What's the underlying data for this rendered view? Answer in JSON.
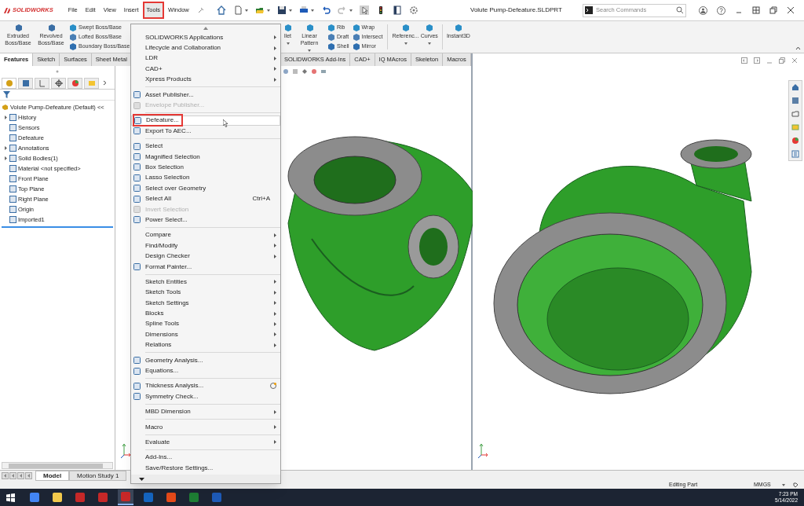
{
  "title_bar": {
    "app_name": "SOLIDWORKS",
    "menus": [
      {
        "label": "File",
        "selected": false,
        "annotated": false
      },
      {
        "label": "Edit",
        "selected": false,
        "annotated": false
      },
      {
        "label": "View",
        "selected": false,
        "annotated": false
      },
      {
        "label": "Insert",
        "selected": false,
        "annotated": false
      },
      {
        "label": "Tools",
        "selected": true,
        "annotated": true
      },
      {
        "label": "Window",
        "selected": false,
        "annotated": false
      }
    ],
    "document_title": "Volute Pump-Defeature.SLDPRT",
    "search": {
      "placeholder": "Search Commands"
    }
  },
  "ribbon": {
    "column_groups": [
      [
        {
          "kind": "large",
          "label": "Extruded Boss/Base"
        },
        {
          "kind": "large",
          "label": "Revolved Boss/Base"
        },
        {
          "kind": "stack",
          "items": [
            "Swept Boss/Base",
            "Lofted Boss/Base",
            "Boundary Boss/Base"
          ]
        }
      ],
      [
        {
          "kind": "large",
          "label": "llet",
          "dropdown": true
        },
        {
          "kind": "large",
          "label": "Linear Pattern",
          "dropdown": true
        },
        {
          "kind": "stack",
          "items": [
            "Rib",
            "Draft",
            "Shell"
          ]
        },
        {
          "kind": "stack",
          "items": [
            "Wrap",
            "Intersect",
            "Mirror"
          ]
        },
        {
          "kind": "separator"
        },
        {
          "kind": "large",
          "label": "Referenc...",
          "dropdown": true
        },
        {
          "kind": "large",
          "label": "Curves",
          "dropdown": true
        },
        {
          "kind": "separator"
        },
        {
          "kind": "large",
          "label": "Instant3D"
        }
      ]
    ],
    "tab_groups": [
      [
        {
          "label": "Features",
          "selected": true
        },
        {
          "label": "Sketch",
          "selected": false
        },
        {
          "label": "Surfaces",
          "selected": false
        },
        {
          "label": "Sheet Metal",
          "selected": false
        }
      ],
      [
        {
          "label": "SOLIDWORKS Add-Ins",
          "selected": false
        },
        {
          "label": "CAD+",
          "selected": false
        },
        {
          "label": "IQ MAcros",
          "selected": false
        },
        {
          "label": "Skeleton",
          "selected": false
        },
        {
          "label": "Macros",
          "selected": false
        }
      ]
    ]
  },
  "feature_manager": {
    "panel_tabs": [
      {
        "selected": true
      },
      {
        "selected": false
      },
      {
        "selected": false
      },
      {
        "selected": false
      },
      {
        "selected": false
      },
      {
        "selected": false
      }
    ],
    "tree": [
      {
        "label": "Volute Pump-Defeature (Default) <<",
        "kind": "root",
        "children": [
          {
            "label": "History",
            "kind": "group",
            "expanded": false
          },
          {
            "label": "Sensors",
            "kind": "item"
          },
          {
            "label": "Defeature",
            "kind": "item"
          },
          {
            "label": "Annotations",
            "kind": "group",
            "expanded": false
          },
          {
            "label": "Solid Bodies(1)",
            "kind": "group",
            "expanded": false
          },
          {
            "label": "Material <not specified>",
            "kind": "item"
          },
          {
            "label": "Front Plane",
            "kind": "item"
          },
          {
            "label": "Top Plane",
            "kind": "item"
          },
          {
            "label": "Right Plane",
            "kind": "item"
          },
          {
            "label": "Origin",
            "kind": "item"
          },
          {
            "label": "Imported1",
            "kind": "item"
          }
        ]
      }
    ]
  },
  "tools_menu": {
    "items": [
      {
        "kind": "command",
        "label": "SOLIDWORKS Applications",
        "submenu": true,
        "disabled": false,
        "icon": false,
        "selected": false,
        "annotated": false
      },
      {
        "kind": "command",
        "label": "Lifecycle and Collaboration",
        "submenu": true,
        "disabled": false,
        "icon": false,
        "selected": false,
        "annotated": false
      },
      {
        "kind": "command",
        "label": "LDR",
        "submenu": true,
        "disabled": false,
        "icon": false,
        "selected": false,
        "annotated": false
      },
      {
        "kind": "command",
        "label": "CAD+",
        "submenu": true,
        "disabled": false,
        "icon": false,
        "selected": false,
        "annotated": false
      },
      {
        "kind": "command",
        "label": "Xpress Products",
        "submenu": true,
        "disabled": false,
        "icon": false,
        "selected": false,
        "annotated": false
      },
      {
        "kind": "separator"
      },
      {
        "kind": "command",
        "label": "Asset Publisher...",
        "submenu": false,
        "disabled": false,
        "icon": true,
        "selected": false,
        "annotated": false
      },
      {
        "kind": "command",
        "label": "Envelope Publisher...",
        "submenu": false,
        "disabled": true,
        "icon": true,
        "selected": false,
        "annotated": false
      },
      {
        "kind": "separator"
      },
      {
        "kind": "command",
        "label": "Defeature...",
        "submenu": false,
        "disabled": false,
        "icon": true,
        "selected": true,
        "annotated": true
      },
      {
        "kind": "command",
        "label": "Export To AEC...",
        "submenu": false,
        "disabled": false,
        "icon": true,
        "selected": false,
        "annotated": false
      },
      {
        "kind": "separator"
      },
      {
        "kind": "command",
        "label": "Select",
        "submenu": false,
        "disabled": false,
        "icon": true,
        "selected": false,
        "annotated": false
      },
      {
        "kind": "command",
        "label": "Magnified Selection",
        "submenu": false,
        "disabled": false,
        "icon": true,
        "selected": false,
        "annotated": false
      },
      {
        "kind": "command",
        "label": "Box Selection",
        "submenu": false,
        "disabled": false,
        "icon": true,
        "selected": false,
        "annotated": false
      },
      {
        "kind": "command",
        "label": "Lasso Selection",
        "submenu": false,
        "disabled": false,
        "icon": true,
        "selected": false,
        "annotated": false
      },
      {
        "kind": "command",
        "label": "Select over Geometry",
        "submenu": false,
        "disabled": false,
        "icon": true,
        "selected": false,
        "annotated": false
      },
      {
        "kind": "command",
        "label": "Select All",
        "shortcut": "Ctrl+A",
        "submenu": false,
        "disabled": false,
        "icon": true,
        "selected": false,
        "annotated": false
      },
      {
        "kind": "command",
        "label": "Invert Selection",
        "submenu": false,
        "disabled": true,
        "icon": true,
        "selected": false,
        "annotated": false
      },
      {
        "kind": "command",
        "label": "Power Select...",
        "submenu": false,
        "disabled": false,
        "icon": true,
        "selected": false,
        "annotated": false
      },
      {
        "kind": "separator"
      },
      {
        "kind": "command",
        "label": "Compare",
        "submenu": true,
        "disabled": false,
        "icon": false,
        "selected": false,
        "annotated": false
      },
      {
        "kind": "command",
        "label": "Find/Modify",
        "submenu": true,
        "disabled": false,
        "icon": false,
        "selected": false,
        "annotated": false
      },
      {
        "kind": "command",
        "label": "Design Checker",
        "submenu": true,
        "disabled": false,
        "icon": false,
        "selected": false,
        "annotated": false
      },
      {
        "kind": "command",
        "label": "Format Painter...",
        "submenu": false,
        "disabled": false,
        "icon": true,
        "selected": false,
        "annotated": false
      },
      {
        "kind": "separator"
      },
      {
        "kind": "command",
        "label": "Sketch Entities",
        "submenu": true,
        "disabled": false,
        "icon": false,
        "selected": false,
        "annotated": false
      },
      {
        "kind": "command",
        "label": "Sketch Tools",
        "submenu": true,
        "disabled": false,
        "icon": false,
        "selected": false,
        "annotated": false
      },
      {
        "kind": "command",
        "label": "Sketch Settings",
        "submenu": true,
        "disabled": false,
        "icon": false,
        "selected": false,
        "annotated": false
      },
      {
        "kind": "command",
        "label": "Blocks",
        "submenu": true,
        "disabled": false,
        "icon": false,
        "selected": false,
        "annotated": false
      },
      {
        "kind": "command",
        "label": "Spline Tools",
        "submenu": true,
        "disabled": false,
        "icon": false,
        "selected": false,
        "annotated": false
      },
      {
        "kind": "command",
        "label": "Dimensions",
        "submenu": true,
        "disabled": false,
        "icon": false,
        "selected": false,
        "annotated": false
      },
      {
        "kind": "command",
        "label": "Relations",
        "submenu": true,
        "disabled": false,
        "icon": false,
        "selected": false,
        "annotated": false
      },
      {
        "kind": "separator"
      },
      {
        "kind": "command",
        "label": "Geometry Analysis...",
        "submenu": false,
        "disabled": false,
        "icon": true,
        "selected": false,
        "annotated": false
      },
      {
        "kind": "command",
        "label": "Equations...",
        "submenu": false,
        "disabled": false,
        "icon": true,
        "selected": false,
        "annotated": false
      },
      {
        "kind": "separator"
      },
      {
        "kind": "command",
        "label": "Thickness Analysis...",
        "submenu": false,
        "disabled": false,
        "icon": true,
        "trailing_icon": true,
        "selected": false,
        "annotated": false
      },
      {
        "kind": "command",
        "label": "Symmetry Check...",
        "submenu": false,
        "disabled": false,
        "icon": true,
        "selected": false,
        "annotated": false
      },
      {
        "kind": "separator"
      },
      {
        "kind": "command",
        "label": "MBD Dimension",
        "submenu": true,
        "disabled": false,
        "icon": false,
        "selected": false,
        "annotated": false
      },
      {
        "kind": "separator"
      },
      {
        "kind": "command",
        "label": "Macro",
        "submenu": true,
        "disabled": false,
        "icon": false,
        "selected": false,
        "annotated": false
      },
      {
        "kind": "separator"
      },
      {
        "kind": "command",
        "label": "Evaluate",
        "submenu": true,
        "disabled": false,
        "icon": false,
        "selected": false,
        "annotated": false
      },
      {
        "kind": "separator"
      },
      {
        "kind": "command",
        "label": "Add-Ins...",
        "submenu": false,
        "disabled": false,
        "icon": false,
        "selected": false,
        "annotated": false
      },
      {
        "kind": "command",
        "label": "Save/Restore Settings...",
        "submenu": false,
        "disabled": false,
        "icon": false,
        "selected": false,
        "annotated": false
      }
    ]
  },
  "bottom_tabs": [
    {
      "label": "Model",
      "selected": true
    },
    {
      "label": "Motion Study 1",
      "selected": false
    }
  ],
  "status_bar": {
    "mode": "Editing Part",
    "units": "MMGS"
  },
  "taskbar": {
    "apps": [
      {
        "color": "#4285f4",
        "selected": false
      },
      {
        "color": "#f2c94c",
        "selected": false
      },
      {
        "color": "#c62828",
        "selected": false
      },
      {
        "color": "#c62828",
        "selected": false
      },
      {
        "color": "#c62828",
        "selected": true
      },
      {
        "color": "#1565c0",
        "selected": false
      },
      {
        "color": "#e64a19",
        "selected": false
      },
      {
        "color": "#1e7e34",
        "selected": false
      },
      {
        "color": "#1e5bb8",
        "selected": false
      }
    ],
    "time": "7:23 PM",
    "date": "5/14/2022"
  }
}
